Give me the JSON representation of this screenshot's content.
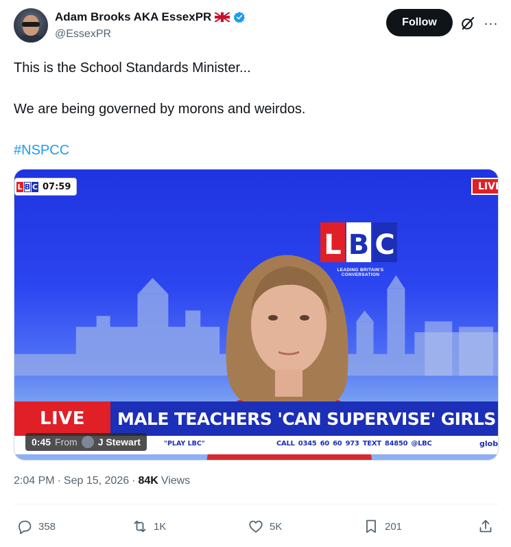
{
  "author": {
    "display_name": "Adam Brooks AKA EssexPR",
    "handle": "@EssexPR"
  },
  "header": {
    "follow_label": "Follow",
    "more_label": "···"
  },
  "tweet": {
    "line1": "This is the School Standards Minister...",
    "line2": "We are being governed by morons and weirdos.",
    "hashtag": "#NSPCC"
  },
  "media": {
    "clock": "07:59",
    "mini_logo": [
      "L",
      "B",
      "C"
    ],
    "logo_letters": [
      "L",
      "B",
      "C"
    ],
    "tagline": "LEADING BRITAIN'S CONVERSATION",
    "live_corner": "LIVE",
    "live_label": "LIVE",
    "headline": "MALE TEACHERS 'CAN SUPERVISE' GIRLS CHANGING",
    "ticker_play": "\"PLAY LBC\"",
    "ticker_call": "CALL 0345 60 60 973   TEXT 84850   @LBC",
    "ticker_glob": "globo",
    "duration": "0:45",
    "from_label": "From",
    "source_name": "J Stewart"
  },
  "meta": {
    "time": "2:04 PM",
    "sep1": "·",
    "date": "Sep 15, 2026",
    "sep2": "·",
    "views_count": "84K",
    "views_label": "Views"
  },
  "actions": {
    "replies": "358",
    "reposts": "1K",
    "likes": "5K",
    "bookmarks": "201"
  },
  "colors": {
    "accent": "#1d9bf0",
    "lbc_red": "#e11f27",
    "lbc_blue": "#1c2fb8",
    "verified": "#1d9bf0"
  },
  "icons": [
    "verified-badge-icon",
    "uk-flag-icon",
    "grok-icon",
    "more-icon",
    "reply-icon",
    "repost-icon",
    "like-icon",
    "bookmark-icon",
    "share-icon"
  ]
}
